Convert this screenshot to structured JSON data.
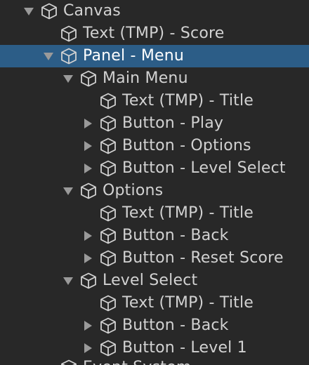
{
  "panel": "Hierarchy",
  "colors": {
    "background": "#282828",
    "selection": "#2c5d87",
    "text": "#d2d2d2",
    "arrow": "#9a9a9a"
  },
  "tree": [
    {
      "label": "Canvas",
      "depth": 0,
      "expander": "expanded",
      "icon": "gameobject-cube-icon",
      "selected": false
    },
    {
      "label": "Text (TMP) - Score",
      "depth": 1,
      "expander": "none",
      "icon": "gameobject-cube-icon",
      "selected": false
    },
    {
      "label": "Panel - Menu",
      "depth": 1,
      "expander": "expanded",
      "icon": "gameobject-cube-icon",
      "selected": true
    },
    {
      "label": "Main Menu",
      "depth": 2,
      "expander": "expanded",
      "icon": "gameobject-cube-icon",
      "selected": false
    },
    {
      "label": "Text (TMP) - Title",
      "depth": 3,
      "expander": "none",
      "icon": "gameobject-cube-icon",
      "selected": false
    },
    {
      "label": "Button - Play",
      "depth": 3,
      "expander": "collapsed",
      "icon": "gameobject-cube-icon",
      "selected": false
    },
    {
      "label": "Button - Options",
      "depth": 3,
      "expander": "collapsed",
      "icon": "gameobject-cube-icon",
      "selected": false
    },
    {
      "label": "Button - Level Select",
      "depth": 3,
      "expander": "collapsed",
      "icon": "gameobject-cube-icon",
      "selected": false
    },
    {
      "label": "Options",
      "depth": 2,
      "expander": "expanded",
      "icon": "gameobject-cube-icon",
      "selected": false
    },
    {
      "label": "Text (TMP) - Title",
      "depth": 3,
      "expander": "none",
      "icon": "gameobject-cube-icon",
      "selected": false
    },
    {
      "label": "Button - Back",
      "depth": 3,
      "expander": "collapsed",
      "icon": "gameobject-cube-icon",
      "selected": false
    },
    {
      "label": "Button - Reset Score",
      "depth": 3,
      "expander": "collapsed",
      "icon": "gameobject-cube-icon",
      "selected": false
    },
    {
      "label": "Level Select",
      "depth": 2,
      "expander": "expanded",
      "icon": "gameobject-cube-icon",
      "selected": false
    },
    {
      "label": "Text (TMP) - Title",
      "depth": 3,
      "expander": "none",
      "icon": "gameobject-cube-icon",
      "selected": false
    },
    {
      "label": "Button - Back",
      "depth": 3,
      "expander": "collapsed",
      "icon": "gameobject-cube-icon",
      "selected": false
    },
    {
      "label": "Button - Level 1",
      "depth": 3,
      "expander": "collapsed",
      "icon": "gameobject-cube-icon",
      "selected": false
    }
  ],
  "cutoff_row": {
    "label": "Event System",
    "depth": 1,
    "expander": "none",
    "icon": "gameobject-cube-icon"
  }
}
